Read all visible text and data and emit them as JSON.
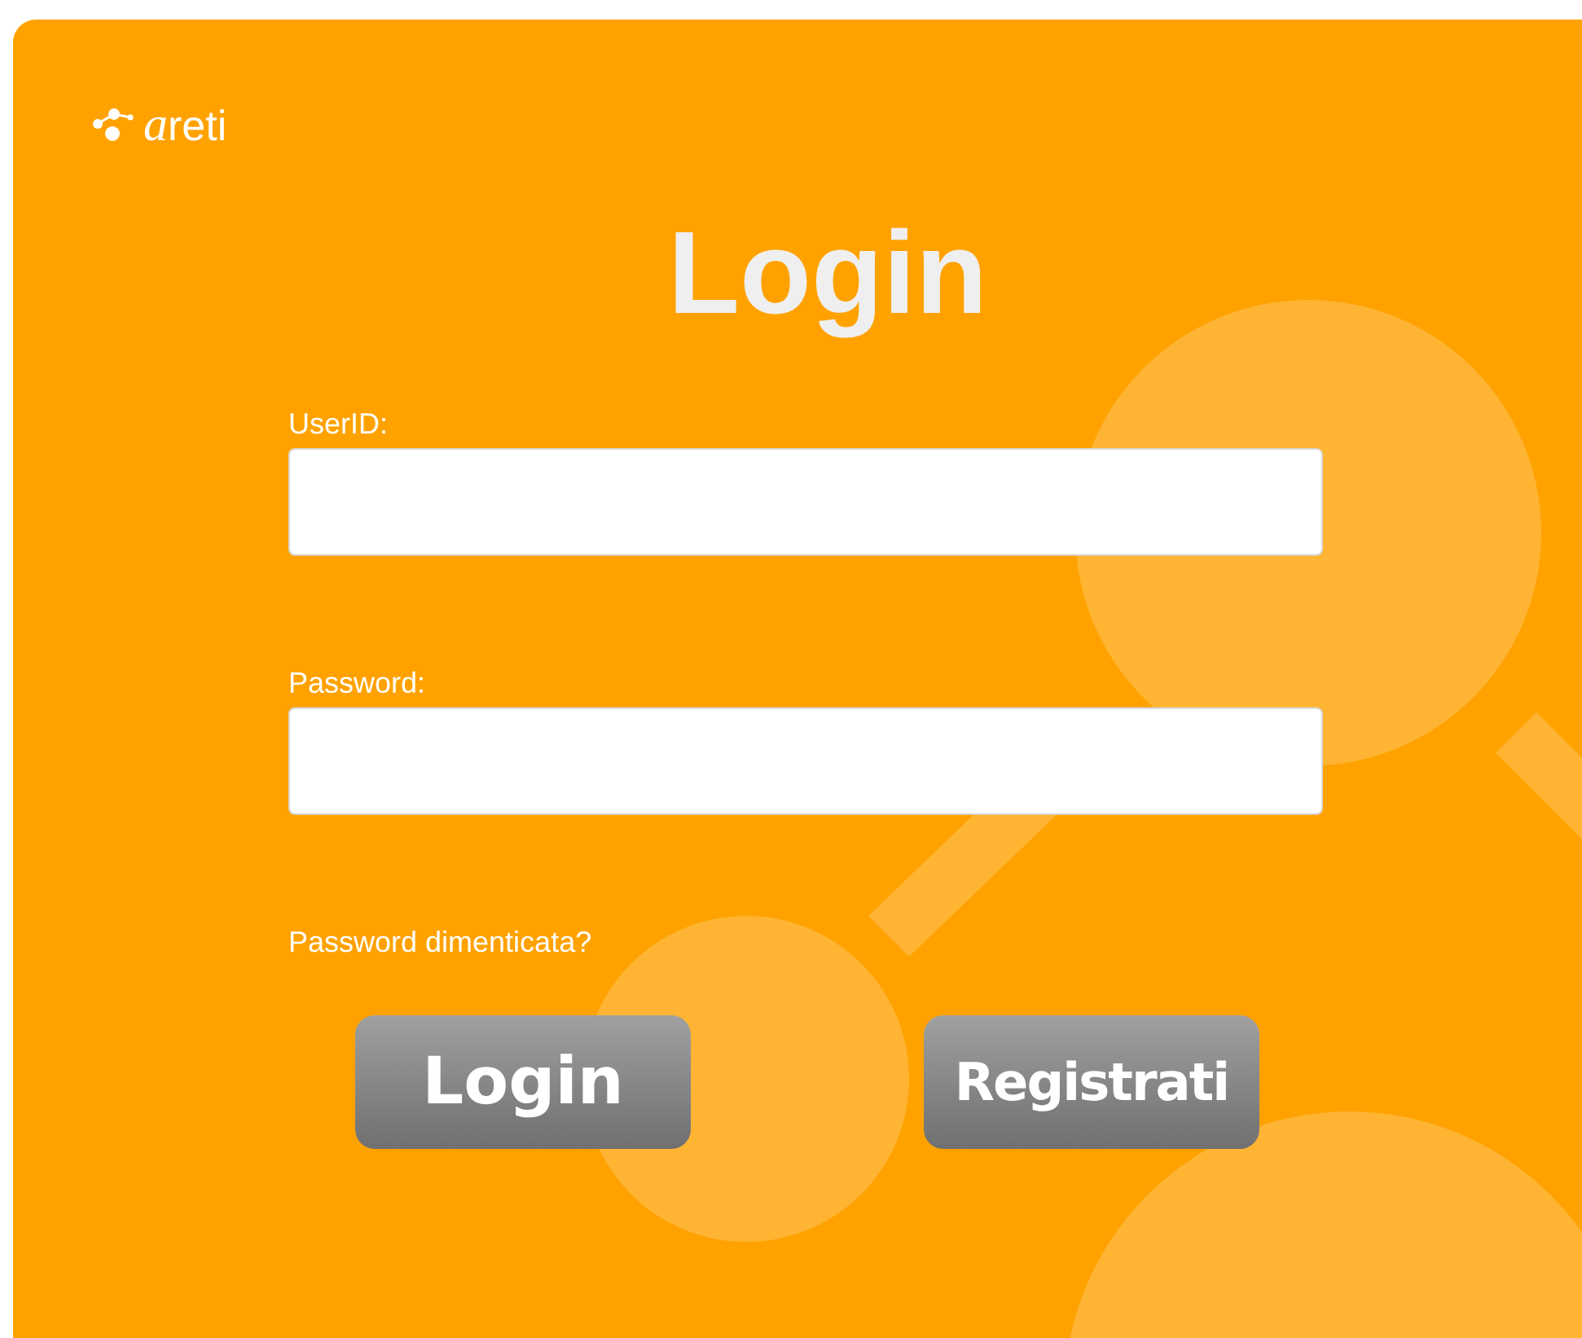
{
  "logo": {
    "text": "areti"
  },
  "title": "Login",
  "fields": [
    {
      "label": "UserID:"
    },
    {
      "label": "Password:"
    }
  ],
  "forgot_link": "Password dimenticata?",
  "buttons": [
    "Login",
    "Registrati"
  ]
}
